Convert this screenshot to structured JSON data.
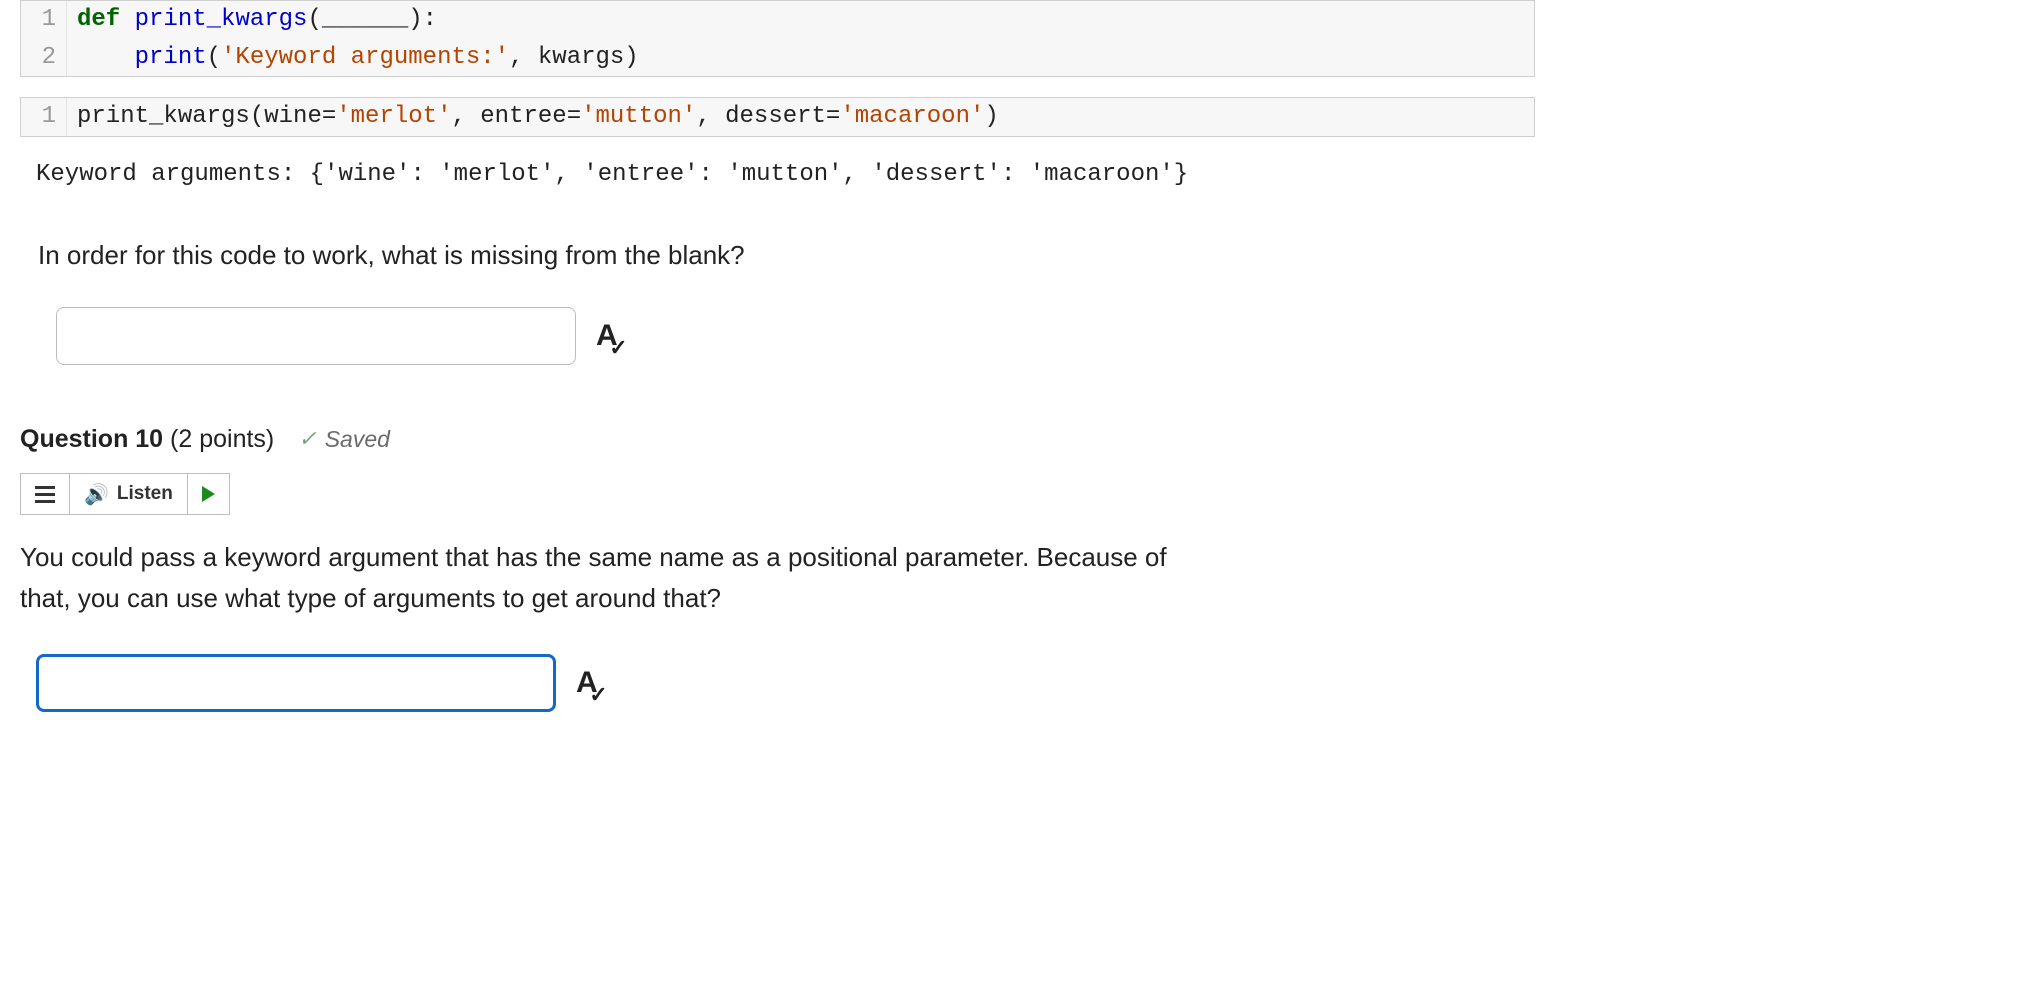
{
  "code_block_1": {
    "lines": [
      {
        "num": "1",
        "segments": [
          {
            "cls": "kw",
            "t": "def"
          },
          {
            "cls": "plain",
            "t": " "
          },
          {
            "cls": "fn",
            "t": "print_kwargs"
          },
          {
            "cls": "plain",
            "t": "(______):"
          }
        ]
      },
      {
        "num": "2",
        "segments": [
          {
            "cls": "plain",
            "t": "    "
          },
          {
            "cls": "fn",
            "t": "print"
          },
          {
            "cls": "plain",
            "t": "("
          },
          {
            "cls": "str",
            "t": "'Keyword arguments:'"
          },
          {
            "cls": "plain",
            "t": ", kwargs)"
          }
        ]
      }
    ]
  },
  "code_block_2": {
    "lines": [
      {
        "num": "1",
        "segments": [
          {
            "cls": "plain",
            "t": "print_kwargs(wine="
          },
          {
            "cls": "str",
            "t": "'merlot'"
          },
          {
            "cls": "plain",
            "t": ", entree="
          },
          {
            "cls": "str",
            "t": "'mutton'"
          },
          {
            "cls": "plain",
            "t": ", dessert="
          },
          {
            "cls": "str",
            "t": "'macaroon'"
          },
          {
            "cls": "plain",
            "t": ")"
          }
        ]
      }
    ]
  },
  "output_text": "Keyword arguments: {'wine': 'merlot', 'entree': 'mutton', 'dessert': 'macaroon'}",
  "q9_prompt": "In order for this code to work, what is missing from the blank?",
  "q9_answer_value": "",
  "q10": {
    "title_prefix": "Question 10",
    "title_points": " (2 points)",
    "saved_label": "Saved",
    "listen_label": "Listen",
    "prompt": "You could pass a keyword argument that has the same name as a positional parameter.  Because of that, you can use what type of arguments to get around that?",
    "answer_value": ""
  }
}
